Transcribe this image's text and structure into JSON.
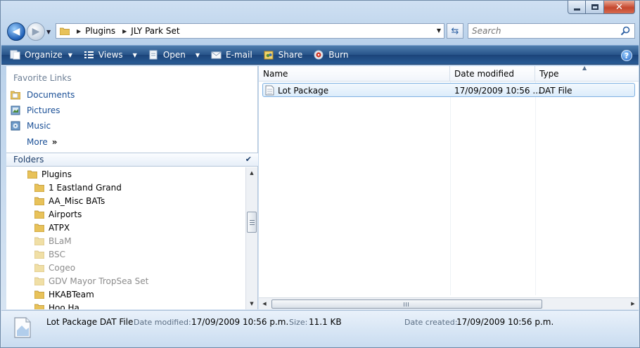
{
  "address": {
    "crumbs": [
      "Plugins",
      "JLY Park Set"
    ]
  },
  "search": {
    "placeholder": "Search"
  },
  "toolbar": {
    "organize": "Organize",
    "views": "Views",
    "open": "Open",
    "email": "E-mail",
    "share": "Share",
    "burn": "Burn",
    "help": "?"
  },
  "favorites": {
    "header": "Favorite Links",
    "items": [
      "Documents",
      "Pictures",
      "Music"
    ],
    "more": "More"
  },
  "folders": {
    "header": "Folders",
    "tree": [
      {
        "label": "Plugins",
        "level": 0,
        "dim": false
      },
      {
        "label": "1 Eastland Grand",
        "level": 1,
        "dim": false
      },
      {
        "label": "AA_Misc BATs",
        "level": 1,
        "dim": false
      },
      {
        "label": "Airports",
        "level": 1,
        "dim": false
      },
      {
        "label": "ATPX",
        "level": 1,
        "dim": false
      },
      {
        "label": "BLaM",
        "level": 1,
        "dim": true
      },
      {
        "label": "BSC",
        "level": 1,
        "dim": true
      },
      {
        "label": "Cogeo",
        "level": 1,
        "dim": true
      },
      {
        "label": "GDV Mayor TropSea Set",
        "level": 1,
        "dim": true
      },
      {
        "label": "HKABTeam",
        "level": 1,
        "dim": false
      },
      {
        "label": "Hoo Ha",
        "level": 1,
        "dim": false
      }
    ]
  },
  "filelist": {
    "columns": [
      "Name",
      "Date modified",
      "Type"
    ],
    "rows": [
      {
        "name": "Lot Package",
        "date": "17/09/2009 10:56 ...",
        "type": "DAT File"
      }
    ]
  },
  "details": {
    "title": "Lot Package DAT File",
    "modified_label": "Date modified:",
    "modified_value": "17/09/2009 10:56 p.m.",
    "size_label": "Size:",
    "size_value": "11.1 KB",
    "created_label": "Date created:",
    "created_value": "17/09/2009 10:56 p.m."
  },
  "colors": {
    "toolbar": "#27548a",
    "link": "#1a4f96",
    "selection": "#dcecfb"
  }
}
